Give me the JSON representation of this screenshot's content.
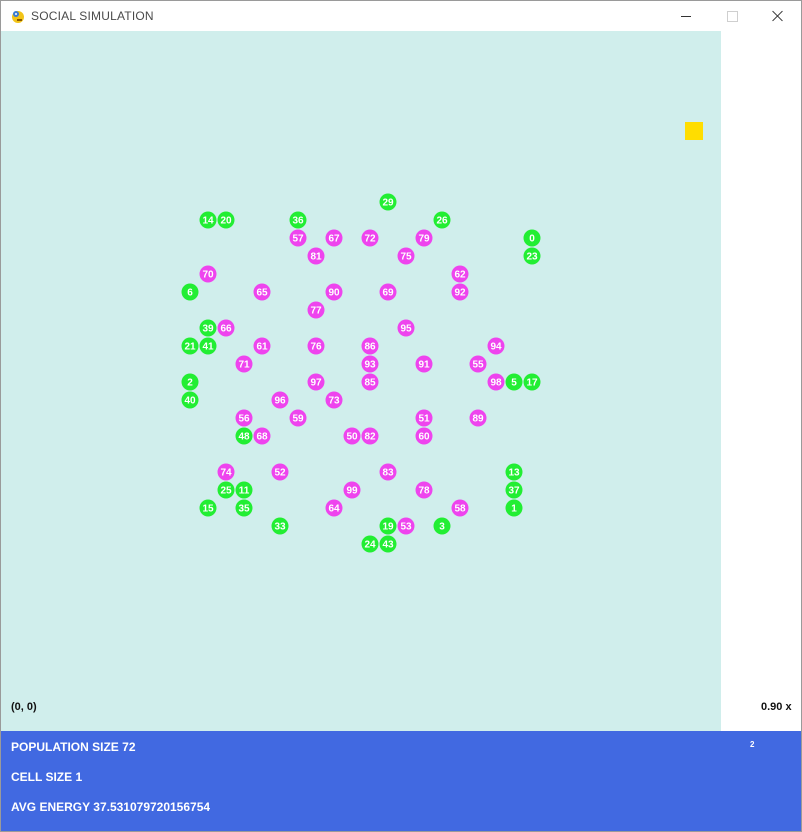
{
  "window": {
    "title": "SOCIAL SIMULATION"
  },
  "viewport": {
    "coord_readout": "(0, 0)",
    "zoom_readout": "0.90 x",
    "side_indicator": "2"
  },
  "stats": {
    "population_label": "POPULATION SIZE",
    "population_value": "72",
    "cell_label": "CELL SIZE",
    "cell_value": "1",
    "energy_label": "AVG ENERGY",
    "energy_value": "37.531079720156754"
  },
  "colors": {
    "background": "#d0eeec",
    "green_agent": "#22ee33",
    "magenta_agent": "#ee44ee",
    "food": "#ffdd00",
    "panel": "#4169e1"
  },
  "food": [
    {
      "name": "food-item"
    }
  ],
  "agents": [
    {
      "id": "29",
      "kind": "green",
      "gx": 21,
      "gy": 9
    },
    {
      "id": "14",
      "kind": "green",
      "gx": 11,
      "gy": 10
    },
    {
      "id": "20",
      "kind": "green",
      "gx": 12,
      "gy": 10
    },
    {
      "id": "36",
      "kind": "green",
      "gx": 16,
      "gy": 10
    },
    {
      "id": "26",
      "kind": "green",
      "gx": 24,
      "gy": 10
    },
    {
      "id": "57",
      "kind": "magenta",
      "gx": 16,
      "gy": 11
    },
    {
      "id": "67",
      "kind": "magenta",
      "gx": 18,
      "gy": 11
    },
    {
      "id": "72",
      "kind": "magenta",
      "gx": 20,
      "gy": 11
    },
    {
      "id": "79",
      "kind": "magenta",
      "gx": 23,
      "gy": 11
    },
    {
      "id": "0",
      "kind": "green",
      "gx": 29,
      "gy": 11
    },
    {
      "id": "81",
      "kind": "magenta",
      "gx": 17,
      "gy": 12
    },
    {
      "id": "75",
      "kind": "magenta",
      "gx": 22,
      "gy": 12
    },
    {
      "id": "23",
      "kind": "green",
      "gx": 29,
      "gy": 12
    },
    {
      "id": "70",
      "kind": "magenta",
      "gx": 11,
      "gy": 13
    },
    {
      "id": "62",
      "kind": "magenta",
      "gx": 25,
      "gy": 13
    },
    {
      "id": "6",
      "kind": "green",
      "gx": 10,
      "gy": 14
    },
    {
      "id": "65",
      "kind": "magenta",
      "gx": 14,
      "gy": 14
    },
    {
      "id": "90",
      "kind": "magenta",
      "gx": 18,
      "gy": 14
    },
    {
      "id": "69",
      "kind": "magenta",
      "gx": 21,
      "gy": 14
    },
    {
      "id": "92",
      "kind": "magenta",
      "gx": 25,
      "gy": 14
    },
    {
      "id": "77",
      "kind": "magenta",
      "gx": 17,
      "gy": 15
    },
    {
      "id": "39",
      "kind": "green",
      "gx": 11,
      "gy": 16
    },
    {
      "id": "66",
      "kind": "magenta",
      "gx": 12,
      "gy": 16
    },
    {
      "id": "95",
      "kind": "magenta",
      "gx": 22,
      "gy": 16
    },
    {
      "id": "21",
      "kind": "green",
      "gx": 10,
      "gy": 17
    },
    {
      "id": "41",
      "kind": "green",
      "gx": 11,
      "gy": 17
    },
    {
      "id": "61",
      "kind": "magenta",
      "gx": 14,
      "gy": 17
    },
    {
      "id": "76",
      "kind": "magenta",
      "gx": 17,
      "gy": 17
    },
    {
      "id": "86",
      "kind": "magenta",
      "gx": 20,
      "gy": 17
    },
    {
      "id": "94",
      "kind": "magenta",
      "gx": 27,
      "gy": 17
    },
    {
      "id": "71",
      "kind": "magenta",
      "gx": 13,
      "gy": 18
    },
    {
      "id": "93",
      "kind": "magenta",
      "gx": 20,
      "gy": 18
    },
    {
      "id": "91",
      "kind": "magenta",
      "gx": 23,
      "gy": 18
    },
    {
      "id": "55",
      "kind": "magenta",
      "gx": 26,
      "gy": 18
    },
    {
      "id": "2",
      "kind": "green",
      "gx": 10,
      "gy": 19
    },
    {
      "id": "97",
      "kind": "magenta",
      "gx": 17,
      "gy": 19
    },
    {
      "id": "85",
      "kind": "magenta",
      "gx": 20,
      "gy": 19
    },
    {
      "id": "98",
      "kind": "magenta",
      "gx": 27,
      "gy": 19
    },
    {
      "id": "5",
      "kind": "green",
      "gx": 28,
      "gy": 19
    },
    {
      "id": "17",
      "kind": "green",
      "gx": 29,
      "gy": 19
    },
    {
      "id": "40",
      "kind": "green",
      "gx": 10,
      "gy": 20
    },
    {
      "id": "96",
      "kind": "magenta",
      "gx": 15,
      "gy": 20
    },
    {
      "id": "73",
      "kind": "magenta",
      "gx": 18,
      "gy": 20
    },
    {
      "id": "56",
      "kind": "magenta",
      "gx": 13,
      "gy": 21
    },
    {
      "id": "59",
      "kind": "magenta",
      "gx": 16,
      "gy": 21
    },
    {
      "id": "51",
      "kind": "magenta",
      "gx": 23,
      "gy": 21
    },
    {
      "id": "89",
      "kind": "magenta",
      "gx": 26,
      "gy": 21
    },
    {
      "id": "48",
      "kind": "green",
      "gx": 13,
      "gy": 22
    },
    {
      "id": "68",
      "kind": "magenta",
      "gx": 14,
      "gy": 22
    },
    {
      "id": "50",
      "kind": "magenta",
      "gx": 19,
      "gy": 22
    },
    {
      "id": "82",
      "kind": "magenta",
      "gx": 20,
      "gy": 22
    },
    {
      "id": "60",
      "kind": "magenta",
      "gx": 23,
      "gy": 22
    },
    {
      "id": "74",
      "kind": "magenta",
      "gx": 12,
      "gy": 24
    },
    {
      "id": "52",
      "kind": "magenta",
      "gx": 15,
      "gy": 24
    },
    {
      "id": "83",
      "kind": "magenta",
      "gx": 21,
      "gy": 24
    },
    {
      "id": "13",
      "kind": "green",
      "gx": 28,
      "gy": 24
    },
    {
      "id": "25",
      "kind": "green",
      "gx": 12,
      "gy": 25
    },
    {
      "id": "11",
      "kind": "green",
      "gx": 13,
      "gy": 25
    },
    {
      "id": "99",
      "kind": "magenta",
      "gx": 19,
      "gy": 25
    },
    {
      "id": "78",
      "kind": "magenta",
      "gx": 23,
      "gy": 25
    },
    {
      "id": "37",
      "kind": "green",
      "gx": 28,
      "gy": 25
    },
    {
      "id": "15",
      "kind": "green",
      "gx": 11,
      "gy": 26
    },
    {
      "id": "35",
      "kind": "green",
      "gx": 13,
      "gy": 26
    },
    {
      "id": "64",
      "kind": "magenta",
      "gx": 18,
      "gy": 26
    },
    {
      "id": "58",
      "kind": "magenta",
      "gx": 25,
      "gy": 26
    },
    {
      "id": "1",
      "kind": "green",
      "gx": 28,
      "gy": 26
    },
    {
      "id": "33",
      "kind": "green",
      "gx": 15,
      "gy": 27
    },
    {
      "id": "19",
      "kind": "green",
      "gx": 21,
      "gy": 27
    },
    {
      "id": "53",
      "kind": "magenta",
      "gx": 22,
      "gy": 27
    },
    {
      "id": "3",
      "kind": "green",
      "gx": 24,
      "gy": 27
    },
    {
      "id": "24",
      "kind": "green",
      "gx": 20,
      "gy": 28
    },
    {
      "id": "43",
      "kind": "green",
      "gx": 21,
      "gy": 28
    }
  ]
}
